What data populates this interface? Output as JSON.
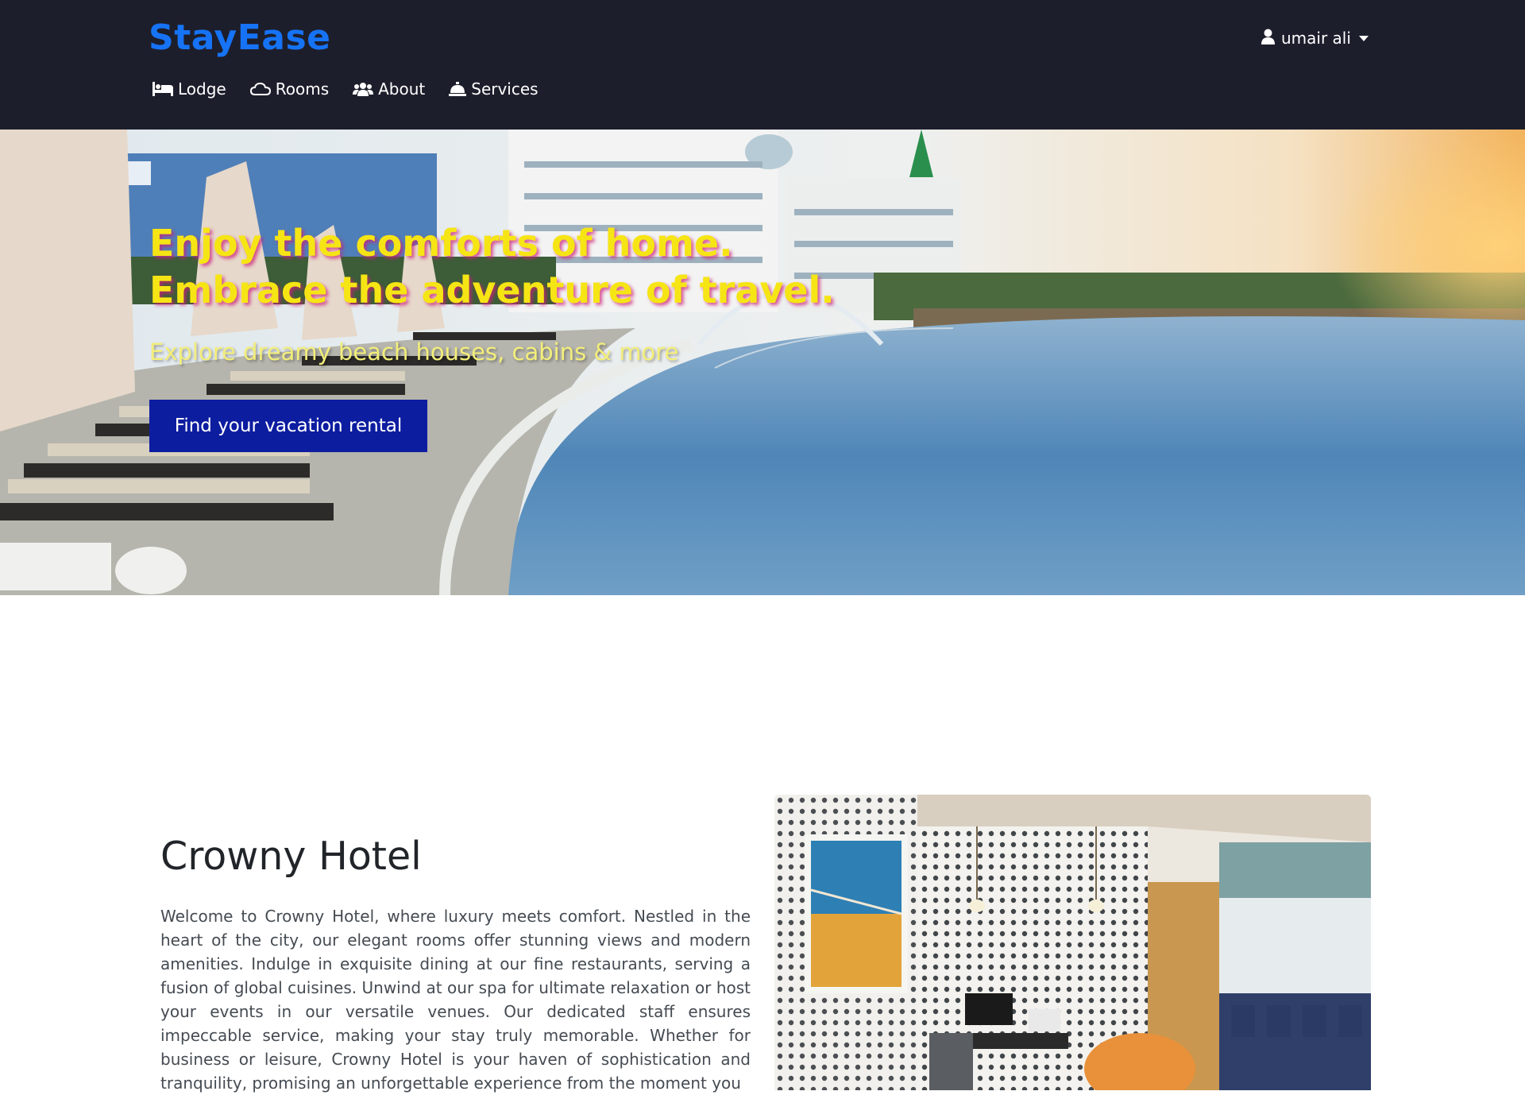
{
  "brand": {
    "name": "StayEase",
    "color": "#1673f5"
  },
  "user_menu": {
    "name": "umair ali",
    "icon": "user-icon"
  },
  "nav": [
    {
      "label": "Lodge",
      "icon": "bed-icon"
    },
    {
      "label": "Rooms",
      "icon": "cloud-icon"
    },
    {
      "label": "About",
      "icon": "users-icon"
    },
    {
      "label": "Services",
      "icon": "concierge-bell-icon"
    }
  ],
  "hero": {
    "title_line1": "Enjoy the comforts of home.",
    "title_line2": "Embrace the adventure of travel.",
    "subtitle": "Explore dreamy beach houses, cabins & more",
    "cta": "Find your vacation rental"
  },
  "about": {
    "title": "Crowny Hotel",
    "text": "Welcome to Crowny Hotel, where luxury meets comfort. Nestled in the heart of the city, our elegant rooms offer stunning views and modern amenities. Indulge in exquisite dining at our fine restaurants, serving a fusion of global cuisines. Unwind at our spa for ultimate relaxation or host your events in our versatile venues. Our dedicated staff ensures impeccable service, making your stay truly memorable. Whether for business or leisure, Crowny Hotel is your haven of sophistication and tranquility, promising an unforgettable experience from the moment you"
  },
  "colors": {
    "navbar_bg": "#1d1e2c",
    "cta_bg": "#0d1da0",
    "hero_title": "#f6e514",
    "hero_title_shadow": "#cd1e78",
    "hero_subtitle": "#f3ee7a"
  }
}
